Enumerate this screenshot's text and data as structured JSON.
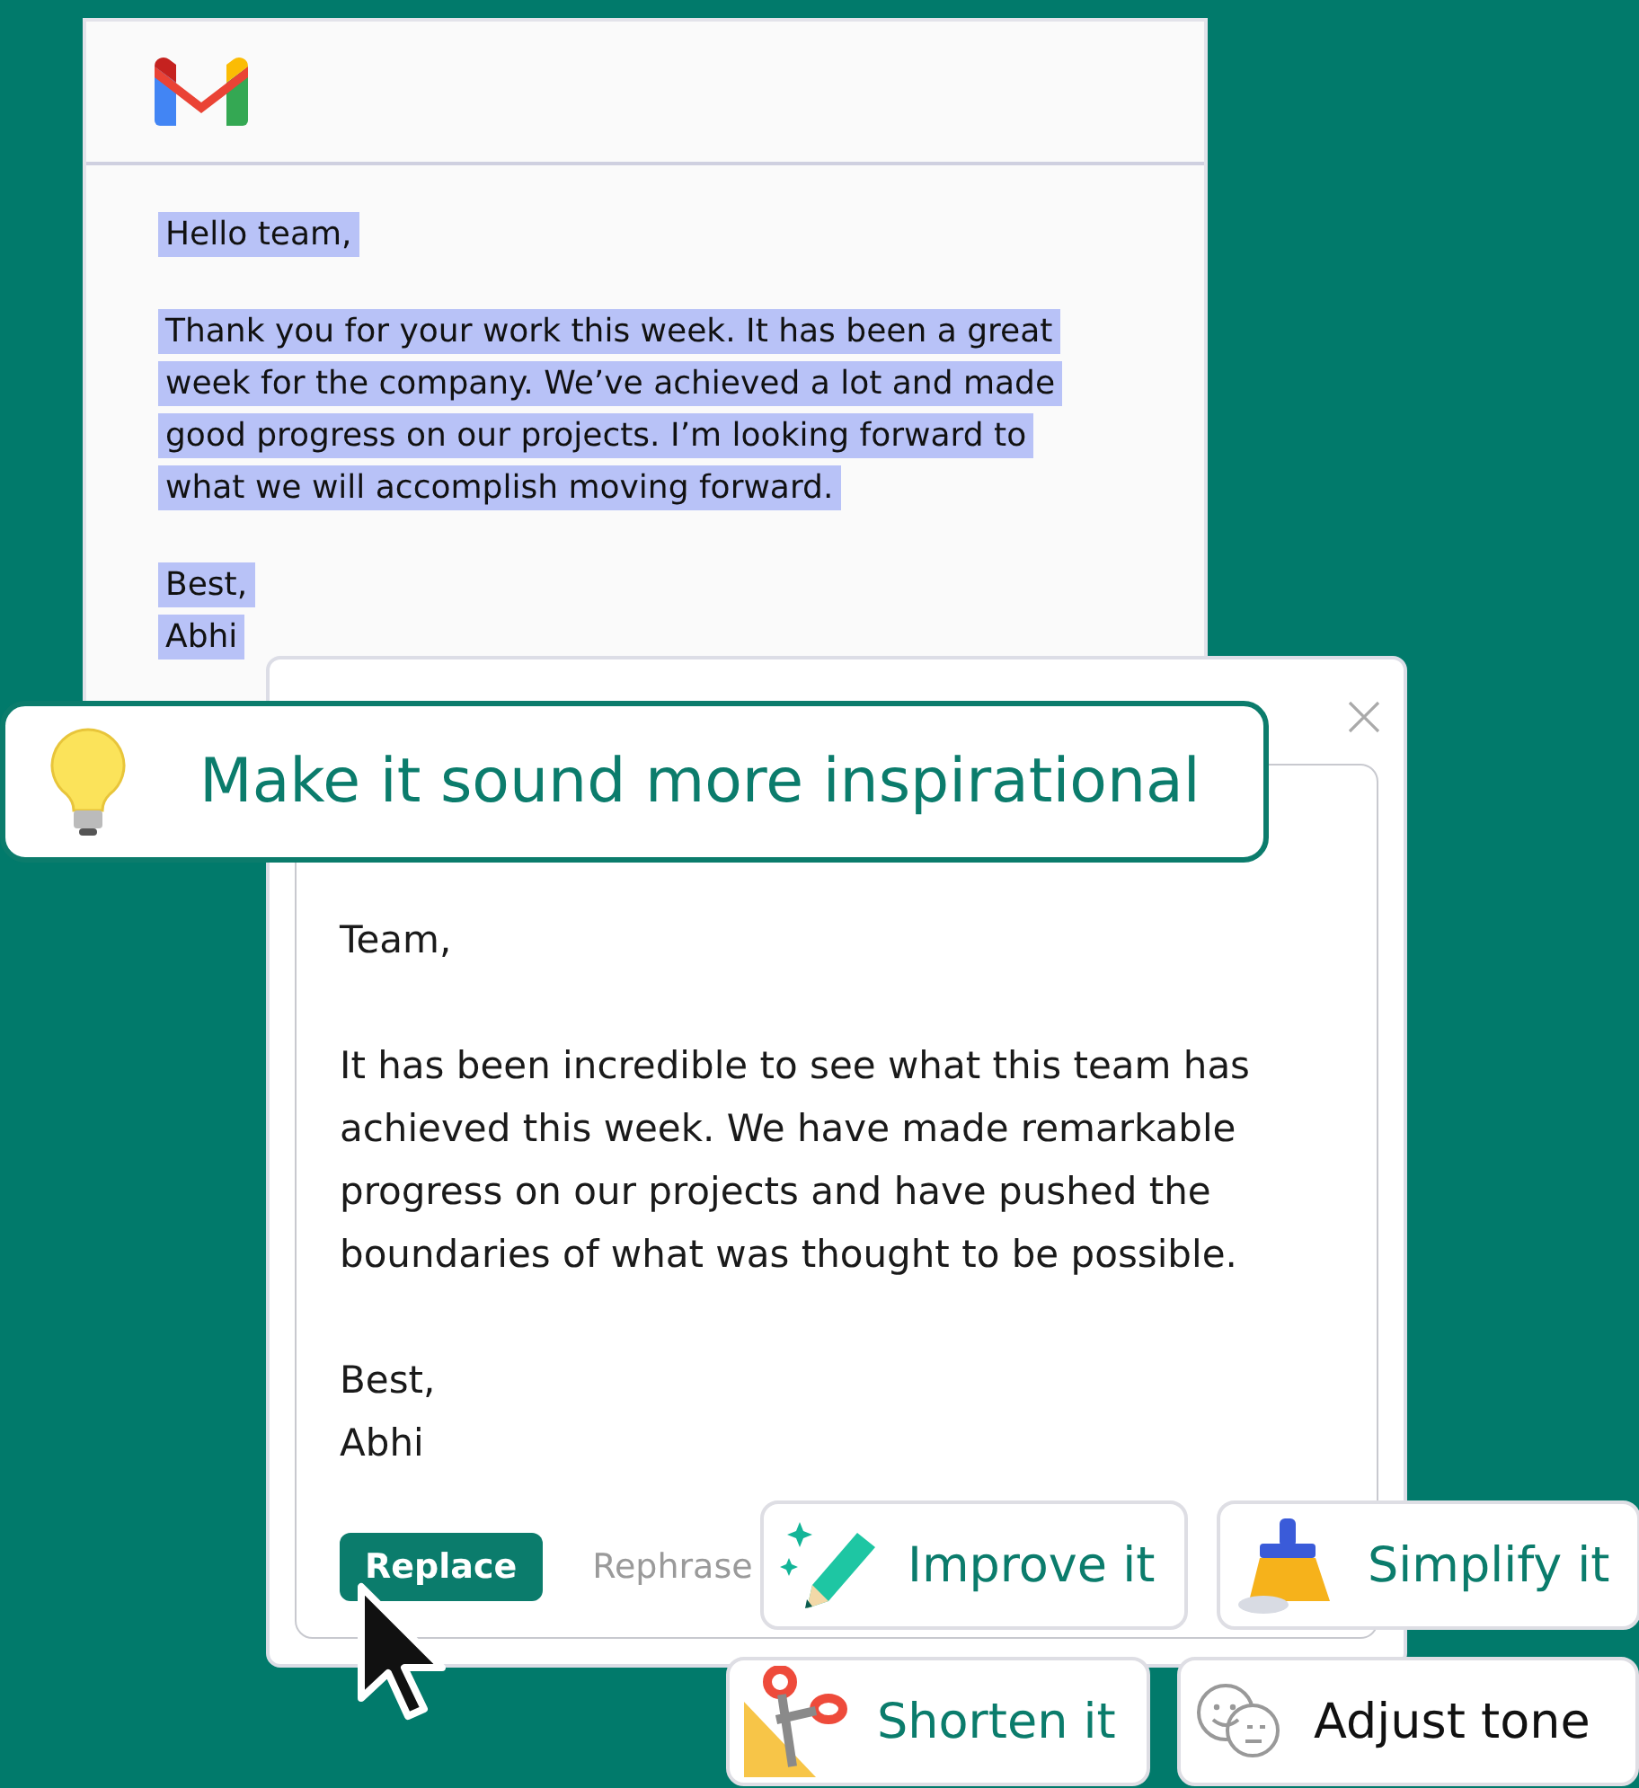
{
  "email": {
    "highlighted": true,
    "paragraphs": [
      [
        "Hello team,"
      ],
      [
        "Thank you for your work this week. It has been a great",
        "week for the company. We’ve achieved a lot and made",
        "good progress on our projects. I’m looking forward to",
        "what we will accomplish moving forward."
      ],
      [
        "Best,",
        "Abhi"
      ]
    ]
  },
  "prompt": {
    "text": "Make it sound more inspirational"
  },
  "result": {
    "paragraphs": [
      [
        "Team,"
      ],
      [
        "It has been incredible to see what this team has",
        "achieved this week. We have made remarkable",
        "progress on our projects and have pushed the",
        "boundaries of what was thought to be possible."
      ],
      [
        "Best,",
        "Abhi"
      ]
    ],
    "buttons": [
      {
        "label": "Replace",
        "kind": "primary"
      },
      {
        "label": "Rephrase",
        "kind": "plain"
      }
    ]
  },
  "actions": [
    {
      "label": "Improve it",
      "kind": "improve"
    },
    {
      "label": "Simplify it",
      "kind": "simplify"
    },
    {
      "label": "Shorten it",
      "kind": "shorten"
    },
    {
      "label": "Adjust tone",
      "kind": "tone"
    }
  ]
}
